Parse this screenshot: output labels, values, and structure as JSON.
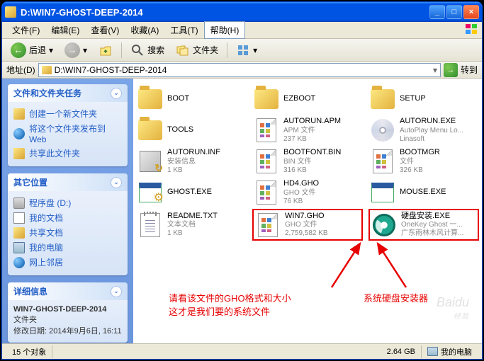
{
  "window": {
    "title": "D:\\WIN7-GHOST-DEEP-2014"
  },
  "menubar": {
    "items": [
      "文件(F)",
      "编辑(E)",
      "查看(V)",
      "收藏(A)",
      "工具(T)"
    ],
    "help": "帮助(H)"
  },
  "toolbar": {
    "back": "后退",
    "search": "搜索",
    "folders": "文件夹"
  },
  "addressbar": {
    "label": "地址(D)",
    "path": "D:\\WIN7-GHOST-DEEP-2014",
    "go": "转到"
  },
  "sidebar": {
    "panels": [
      {
        "title": "文件和文件夹任务",
        "tasks": [
          "创建一个新文件夹",
          "将这个文件夹发布到 Web",
          "共享此文件夹"
        ]
      },
      {
        "title": "其它位置",
        "tasks": [
          "程序盘 (D:)",
          "我的文档",
          "共享文档",
          "我的电脑",
          "网上邻居"
        ]
      },
      {
        "title": "详细信息",
        "detail_name": "WIN7-GHOST-DEEP-2014",
        "detail_type": "文件夹",
        "detail_date_label": "修改日期:",
        "detail_date": "2014年9月6日, 16:11"
      }
    ]
  },
  "files": [
    {
      "name": "BOOT",
      "type": "folder"
    },
    {
      "name": "EZBOOT",
      "type": "folder"
    },
    {
      "name": "SETUP",
      "type": "folder"
    },
    {
      "name": "TOOLS",
      "type": "folder"
    },
    {
      "name": "AUTORUN.APM",
      "meta1": "APM 文件",
      "meta2": "237 KB",
      "type": "grid"
    },
    {
      "name": "AUTORUN.EXE",
      "meta1": "AutoPlay Menu Lo...",
      "meta2": "Linasoft",
      "type": "cd"
    },
    {
      "name": "AUTORUN.INF",
      "meta1": "安装信息",
      "meta2": "1 KB",
      "type": "setup"
    },
    {
      "name": "BOOTFONT.BIN",
      "meta1": "BIN 文件",
      "meta2": "316 KB",
      "type": "grid"
    },
    {
      "name": "BOOTMGR",
      "meta1": "文件",
      "meta2": "326 KB",
      "type": "grid"
    },
    {
      "name": "GHOST.EXE",
      "type": "exewin-gear"
    },
    {
      "name": "HD4.GHO",
      "meta1": "GHO 文件",
      "meta2": "76 KB",
      "type": "grid"
    },
    {
      "name": "MOUSE.EXE",
      "type": "exewin"
    },
    {
      "name": "README.TXT",
      "meta1": "文本文档",
      "meta2": "1 KB",
      "type": "txt"
    },
    {
      "name": "WIN7.GHO",
      "meta1": "GHO 文件",
      "meta2": "2,759,582 KB",
      "type": "grid",
      "boxed": true
    },
    {
      "name": "硬盘安装.EXE",
      "meta1": "OneKey Ghost 一...",
      "meta2": "广东雨林木风计算...",
      "type": "swirl",
      "boxed": true
    }
  ],
  "annotations": {
    "left_line1": "请看该文件的GHO格式和大小",
    "left_line2": "这才是我们要的系统文件",
    "right": "系统硬盘安装器"
  },
  "statusbar": {
    "objects": "15 个对象",
    "size": "2.64 GB",
    "location": "我的电脑"
  },
  "watermark": {
    "brand": "Baidu",
    "sub": "经验"
  }
}
